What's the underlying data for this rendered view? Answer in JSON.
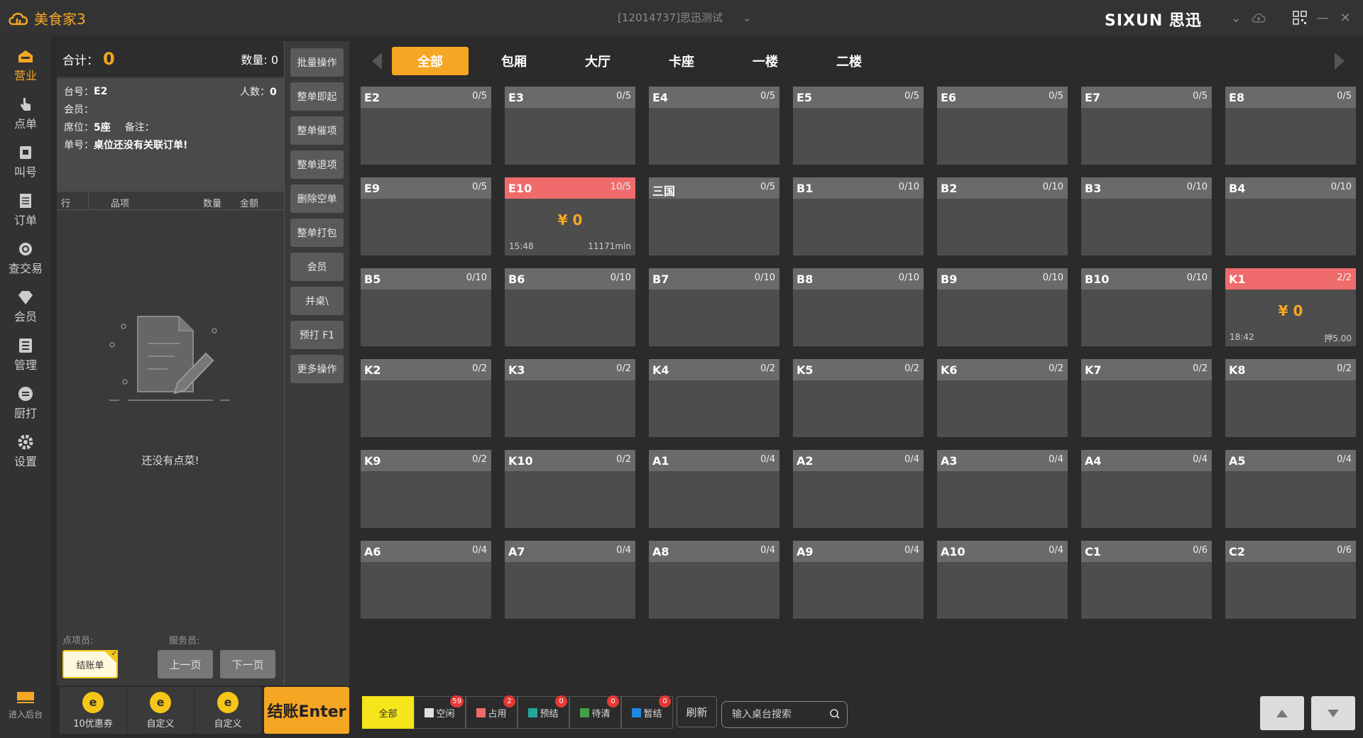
{
  "app": {
    "name": "美食家3",
    "store": "[12014737]思迅测试",
    "brand": "SIXUN 思迅"
  },
  "nav": [
    {
      "label": "营业",
      "icon": "shop-icon",
      "active": true
    },
    {
      "label": "点单",
      "icon": "hand-pointer-icon",
      "active": false
    },
    {
      "label": "叫号",
      "icon": "calling-icon",
      "active": false
    },
    {
      "label": "订单",
      "icon": "document-icon",
      "active": false
    },
    {
      "label": "查交易",
      "icon": "magnifier-icon",
      "active": false
    },
    {
      "label": "会员",
      "icon": "diamond-icon",
      "active": false
    },
    {
      "label": "管理",
      "icon": "list-icon",
      "active": false
    },
    {
      "label": "厨打",
      "icon": "chef-icon",
      "active": false
    },
    {
      "label": "设置",
      "icon": "gear-icon",
      "active": false
    }
  ],
  "nav_bottom": {
    "label": "进入后台",
    "icon": "backstage-icon"
  },
  "order": {
    "total_label": "合计：",
    "total": "0",
    "count_label": "数量:",
    "count": "0",
    "table_label": "台号：",
    "table": "E2",
    "people_label": "人数：",
    "people": "0",
    "member_label": "会员：",
    "seat_label": "席位：",
    "seat": "5座",
    "remark_label": "备注：",
    "order_no_label": "单号：",
    "order_no": "桌位还没有关联订单!",
    "columns": [
      "行",
      "品项",
      "数量",
      "金额"
    ],
    "empty_text": "还没有点菜!",
    "staff1_label": "点项员:",
    "staff2_label": "服务员:",
    "bill_btn": "结账单",
    "prev_btn": "上一页",
    "next_btn": "下一页"
  },
  "ops": [
    "批量操作",
    "整单即起",
    "整单催项",
    "整单退项",
    "删除空单",
    "整单打包",
    "会员",
    "并桌\\",
    "预打 F1",
    "更多操作"
  ],
  "bottom_actions": [
    {
      "label": "10优惠券",
      "icon": "coupon-icon"
    },
    {
      "label": "自定义",
      "icon": "custom-icon"
    },
    {
      "label": "自定义",
      "icon": "custom-icon"
    }
  ],
  "pay_btn": "结账Enter",
  "tabs": [
    "全部",
    "包厢",
    "大厅",
    "卡座",
    "一楼",
    "二楼"
  ],
  "tables": [
    {
      "name": "E2",
      "cap": "0/5"
    },
    {
      "name": "E3",
      "cap": "0/5"
    },
    {
      "name": "E4",
      "cap": "0/5"
    },
    {
      "name": "E5",
      "cap": "0/5"
    },
    {
      "name": "E6",
      "cap": "0/5"
    },
    {
      "name": "E7",
      "cap": "0/5"
    },
    {
      "name": "E8",
      "cap": "0/5"
    },
    {
      "name": "E9",
      "cap": "0/5"
    },
    {
      "name": "E10",
      "cap": "10/5",
      "busy": true,
      "amount": "¥ 0",
      "time": "15:48",
      "extra": "11171min"
    },
    {
      "name": "三国",
      "cap": "0/5"
    },
    {
      "name": "B1",
      "cap": "0/10"
    },
    {
      "name": "B2",
      "cap": "0/10"
    },
    {
      "name": "B3",
      "cap": "0/10"
    },
    {
      "name": "B4",
      "cap": "0/10"
    },
    {
      "name": "B5",
      "cap": "0/10"
    },
    {
      "name": "B6",
      "cap": "0/10"
    },
    {
      "name": "B7",
      "cap": "0/10"
    },
    {
      "name": "B8",
      "cap": "0/10"
    },
    {
      "name": "B9",
      "cap": "0/10"
    },
    {
      "name": "B10",
      "cap": "0/10"
    },
    {
      "name": "K1",
      "cap": "2/2",
      "busy": true,
      "amount": "¥ 0",
      "time": "18:42",
      "extra": "押5.00"
    },
    {
      "name": "K2",
      "cap": "0/2"
    },
    {
      "name": "K3",
      "cap": "0/2"
    },
    {
      "name": "K4",
      "cap": "0/2"
    },
    {
      "name": "K5",
      "cap": "0/2"
    },
    {
      "name": "K6",
      "cap": "0/2"
    },
    {
      "name": "K7",
      "cap": "0/2"
    },
    {
      "name": "K8",
      "cap": "0/2"
    },
    {
      "name": "K9",
      "cap": "0/2"
    },
    {
      "name": "K10",
      "cap": "0/2"
    },
    {
      "name": "A1",
      "cap": "0/4"
    },
    {
      "name": "A2",
      "cap": "0/4"
    },
    {
      "name": "A3",
      "cap": "0/4"
    },
    {
      "name": "A4",
      "cap": "0/4"
    },
    {
      "name": "A5",
      "cap": "0/4"
    },
    {
      "name": "A6",
      "cap": "0/4"
    },
    {
      "name": "A7",
      "cap": "0/4"
    },
    {
      "name": "A8",
      "cap": "0/4"
    },
    {
      "name": "A9",
      "cap": "0/4"
    },
    {
      "name": "A10",
      "cap": "0/4"
    },
    {
      "name": "C1",
      "cap": "0/6"
    },
    {
      "name": "C2",
      "cap": "0/6"
    }
  ],
  "status_filters": [
    {
      "label": "全部",
      "active": true
    },
    {
      "label": "空闲",
      "badge": "59",
      "color": "#e0e0e0"
    },
    {
      "label": "占用",
      "badge": "2",
      "color": "#f06b6b"
    },
    {
      "label": "预结",
      "badge": "0",
      "color": "#26a69a"
    },
    {
      "label": "待清",
      "badge": "0",
      "color": "#43a047"
    },
    {
      "label": "暂结",
      "badge": "0",
      "color": "#1e88e5"
    }
  ],
  "refresh": "刷新",
  "search": {
    "placeholder": "输入桌台搜索"
  }
}
